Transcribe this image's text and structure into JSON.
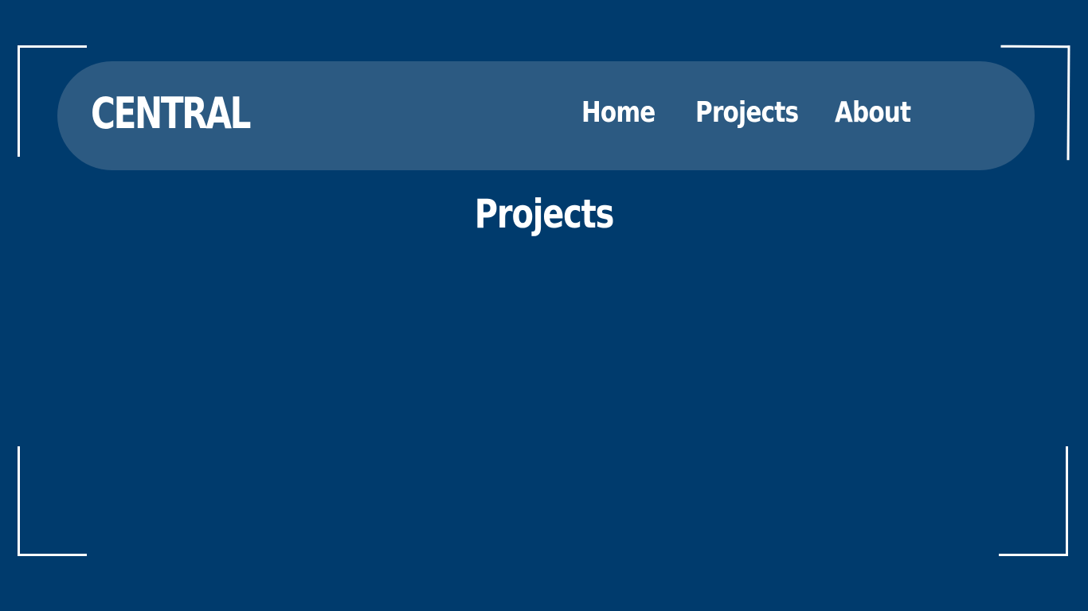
{
  "colors": {
    "background": "#003b6d",
    "navbar": "#2c5a82",
    "text": "#ffffff",
    "frame": "#ffffff"
  },
  "header": {
    "brand": "CENTRAL",
    "nav": [
      {
        "label": "Home"
      },
      {
        "label": "Projects"
      },
      {
        "label": "About"
      }
    ]
  },
  "main": {
    "title": "Projects"
  }
}
